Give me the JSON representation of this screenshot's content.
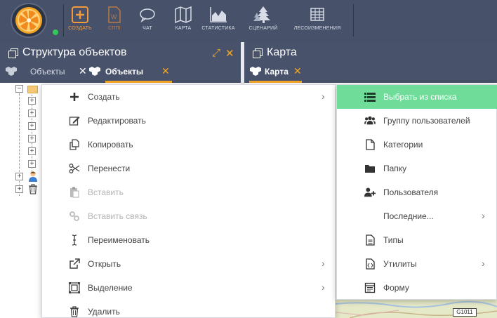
{
  "toolbar": {
    "buttons": [
      {
        "label": "СОЗДАТЬ",
        "icon": "plus-square-icon"
      },
      {
        "label": "СППI",
        "icon": "document-w-icon"
      },
      {
        "label": "ЧАТ",
        "icon": "chat-bubble-icon"
      },
      {
        "label": "КАРТА",
        "icon": "map-icon"
      },
      {
        "label": "СТАТИСТИКА",
        "icon": "area-chart-icon"
      },
      {
        "label": "СЦЕНАРИЙ",
        "icon": "trees-icon"
      },
      {
        "label": "ЛЕСОИЗМЕНЕНИЯ",
        "icon": "grid-table-icon"
      }
    ],
    "accent_color": "#f39a3b",
    "status_color": "#34c759"
  },
  "left_panel": {
    "title": "Структура объектов",
    "tabs": [
      {
        "label": "Объекты",
        "active": false
      },
      {
        "label": "Объекты",
        "active": true
      }
    ]
  },
  "right_panel": {
    "title": "Карта",
    "tabs": [
      {
        "label": "Карта",
        "active": true
      }
    ]
  },
  "context_menu": {
    "items": [
      {
        "label": "Создать",
        "icon": "plus-icon",
        "has_submenu": true,
        "disabled": false
      },
      {
        "label": "Редактировать",
        "icon": "edit-icon",
        "has_submenu": false,
        "disabled": false
      },
      {
        "label": "Копировать",
        "icon": "copy-icon",
        "has_submenu": false,
        "disabled": false
      },
      {
        "label": "Перенести",
        "icon": "scissors-icon",
        "has_submenu": false,
        "disabled": false
      },
      {
        "label": "Вставить",
        "icon": "paste-icon",
        "has_submenu": false,
        "disabled": true
      },
      {
        "label": "Вставить связь",
        "icon": "link-icon",
        "has_submenu": false,
        "disabled": true
      },
      {
        "label": "Переименовать",
        "icon": "text-cursor-icon",
        "has_submenu": false,
        "disabled": false
      },
      {
        "label": "Открыть",
        "icon": "external-link-icon",
        "has_submenu": true,
        "disabled": false
      },
      {
        "label": "Выделение",
        "icon": "select-icon",
        "has_submenu": true,
        "disabled": false
      },
      {
        "label": "Удалить",
        "icon": "trash-icon",
        "has_submenu": false,
        "disabled": false
      }
    ]
  },
  "submenu": {
    "items": [
      {
        "label": "Выбрать из списка",
        "icon": "list-icon",
        "highlighted": true,
        "has_submenu": false
      },
      {
        "label": "Группу пользователей",
        "icon": "users-icon",
        "highlighted": false,
        "has_submenu": false
      },
      {
        "label": "Категории",
        "icon": "file-icon",
        "highlighted": false,
        "has_submenu": false
      },
      {
        "label": "Папку",
        "icon": "folder-icon",
        "highlighted": false,
        "has_submenu": false
      },
      {
        "label": "Пользователя",
        "icon": "user-plus-icon",
        "highlighted": false,
        "has_submenu": false
      },
      {
        "label": "Последние...",
        "icon": "",
        "highlighted": false,
        "has_submenu": true
      },
      {
        "label": "Типы",
        "icon": "file-text-icon",
        "highlighted": false,
        "has_submenu": false
      },
      {
        "label": "Утилиты",
        "icon": "file-code-icon",
        "highlighted": false,
        "has_submenu": true
      },
      {
        "label": "Форму",
        "icon": "form-icon",
        "highlighted": false,
        "has_submenu": false
      }
    ],
    "highlight_color": "#6fdc9a"
  },
  "map": {
    "road_label": "G1011"
  }
}
